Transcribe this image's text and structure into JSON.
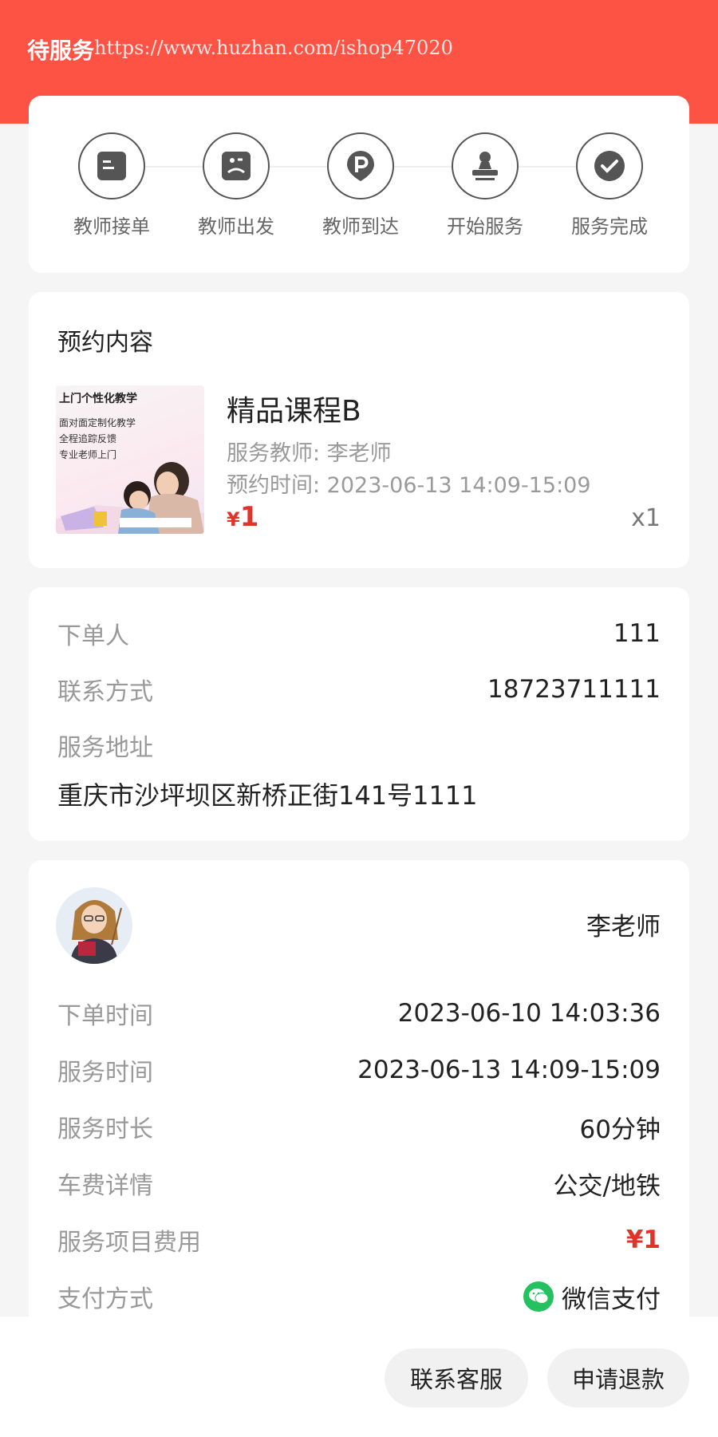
{
  "header": {
    "title": "待服务",
    "watermark": "https://www.huzhan.com/ishop47020"
  },
  "progress": {
    "steps": [
      {
        "label": "教师接单",
        "icon": "note-icon"
      },
      {
        "label": "教师出发",
        "icon": "depart-icon"
      },
      {
        "label": "教师到达",
        "icon": "location-p-icon"
      },
      {
        "label": "开始服务",
        "icon": "stamp-icon"
      },
      {
        "label": "服务完成",
        "icon": "check-icon"
      }
    ]
  },
  "booking": {
    "title": "预约内容",
    "image": {
      "headline": "上门个性化教学",
      "lines": [
        "面对面定制化教学",
        "全程追踪反馈",
        "专业老师上门"
      ]
    },
    "product_name": "精品课程B",
    "teacher_line": "服务教师:  李老师",
    "time_line": "预约时间:  2023-06-13 14:09-15:09",
    "currency": "¥",
    "price": "1",
    "quantity": "x1"
  },
  "contact": {
    "orderer_label": "下单人",
    "orderer_value": "111",
    "phone_label": "联系方式",
    "phone_value": "18723711111",
    "address_label": "服务地址",
    "address_value": "重庆市沙坪坝区新桥正街141号1111"
  },
  "detail": {
    "teacher_name": "李老师",
    "rows": [
      {
        "label": "下单时间",
        "value": "2023-06-10 14:03:36"
      },
      {
        "label": "服务时间",
        "value": "2023-06-13 14:09-15:09"
      },
      {
        "label": "服务时长",
        "value": "60分钟"
      },
      {
        "label": "车费详情",
        "value": "公交/地铁"
      },
      {
        "label": "服务项目费用",
        "value": "¥1"
      },
      {
        "label": "支付方式",
        "value": "微信支付"
      }
    ]
  },
  "actions": {
    "contact_service": "联系客服",
    "refund": "申请退款"
  },
  "colors": {
    "header": "#fc5344",
    "price": "#e0342a",
    "wechat": "#25c060"
  }
}
